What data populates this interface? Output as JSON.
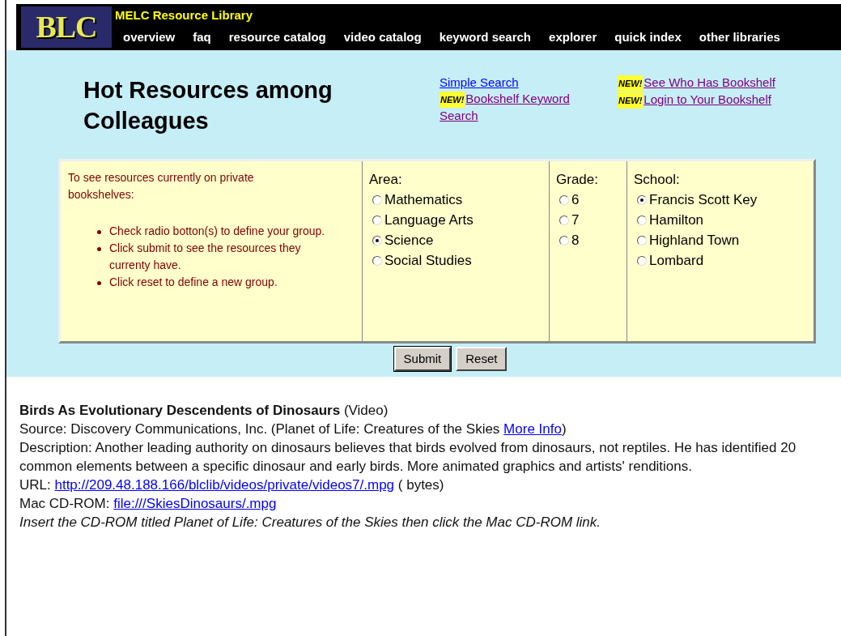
{
  "header": {
    "logo": "BLC",
    "title": "MELC Resource Library",
    "nav": [
      "overview",
      "faq",
      "resource catalog",
      "video catalog",
      "keyword search",
      "explorer",
      "quick index",
      "other libraries"
    ]
  },
  "heading": "Hot Resources among Colleagues",
  "link_columns": [
    [
      {
        "text": "Simple Search",
        "visited": false
      },
      {
        "badge": "NEW!",
        "text": "Bookshelf Keyword Search",
        "visited": true
      }
    ],
    [
      {
        "badge": "NEW!",
        "text": "See Who Has Bookshelf",
        "visited": true
      },
      {
        "badge": "NEW!",
        "text": "Login to Your Bookshelf",
        "visited": true
      }
    ]
  ],
  "intro": {
    "text": "To see resources currently on private bookshelves:",
    "bullets": [
      "Check radio botton(s) to define your group.",
      "Click submit to see the resources they currenty have.",
      "Click reset to define a new group."
    ]
  },
  "groups": [
    {
      "label": "Area:",
      "options": [
        {
          "label": "Mathematics",
          "selected": false
        },
        {
          "label": "Language Arts",
          "selected": false
        },
        {
          "label": "Science",
          "selected": true
        },
        {
          "label": "Social Studies",
          "selected": false
        }
      ]
    },
    {
      "label": "Grade:",
      "options": [
        {
          "label": "6",
          "selected": false
        },
        {
          "label": "7",
          "selected": false
        },
        {
          "label": "8",
          "selected": false
        }
      ]
    },
    {
      "label": "School:",
      "options": [
        {
          "label": "Francis Scott Key",
          "selected": true
        },
        {
          "label": "Hamilton",
          "selected": false
        },
        {
          "label": "Highland Town",
          "selected": false
        },
        {
          "label": "Lombard",
          "selected": false
        }
      ]
    }
  ],
  "buttons": [
    "Submit",
    "Reset"
  ],
  "result": {
    "title": "Birds As Evolutionary Descendents of Dinosaurs",
    "type": "(Video)",
    "source": {
      "prefix": "Source: Discovery Communications, Inc. (Planet of Life: Creatures of the Skies",
      "link": "More Info",
      "suffix": ")"
    },
    "description": "Description: Another leading authority on dinosaurs believes that birds evolved from dinosaurs, not reptiles. He has identified 20 common elements between a specific dinosaur and early birds. More animated graphics and artists' renditions.",
    "url": {
      "prefix": "URL:",
      "link": "http://209.48.188.166/blclib/videos/private/videos7/.mpg",
      "suffix": "( bytes)"
    },
    "cdrom": {
      "prefix": "Mac CD-ROM:",
      "link": "file:///SkiesDinosaurs/.mpg"
    },
    "note": "Insert the CD-ROM titled Planet of Life: Creatures of the Skies then click the Mac CD-ROM link."
  }
}
